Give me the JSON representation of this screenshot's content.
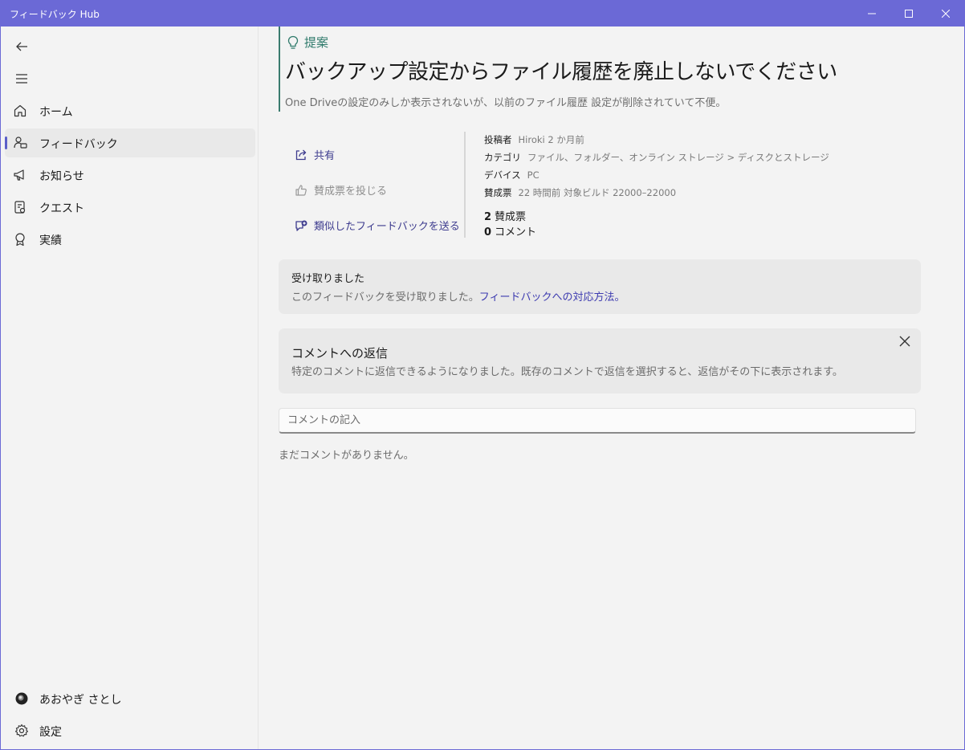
{
  "window": {
    "title": "フィードバック Hub",
    "accent_color": "#6b69d6"
  },
  "sidebar": {
    "items": [
      {
        "label": "ホーム",
        "icon": "home-icon"
      },
      {
        "label": "フィードバック",
        "icon": "feedback-icon",
        "selected": true
      },
      {
        "label": "お知らせ",
        "icon": "megaphone-icon"
      },
      {
        "label": "クエスト",
        "icon": "quest-icon"
      },
      {
        "label": "実績",
        "icon": "achievement-icon"
      }
    ],
    "user": {
      "name": "あおやぎ さとし"
    },
    "settings_label": "設定"
  },
  "post": {
    "category_label": "提案",
    "title": "バックアップ設定からファイル履歴を廃止しないでください",
    "description": "One Driveの設定のみしか表示されないが、以前のファイル履歴 設定が削除されていて不便。"
  },
  "actions": {
    "share": "共有",
    "upvote": "賛成票を投じる",
    "similar": "類似したフィードバックを送る"
  },
  "meta": {
    "author_key": "投稿者",
    "author_value": "Hiroki 2 か月前",
    "category_key": "カテゴリ",
    "category_value": "ファイル、フォルダー、オンライン ストレージ > ディスクとストレージ",
    "device_key": "デバイス",
    "device_value": "PC",
    "votes_key": "賛成票",
    "votes_value": "22 時間前  対象ビルド 22000–22000",
    "vote_count": "2",
    "vote_count_label": "賛成票",
    "comment_count": "0",
    "comment_count_label": "コメント"
  },
  "status_card": {
    "title": "受け取りました",
    "text": "このフィードバックを受け取りました。",
    "link": "フィードバックへの対応方法。"
  },
  "reply_card": {
    "title": "コメントへの返信",
    "text": "特定のコメントに返信できるようになりました。既存のコメントで返信を選択すると、返信がその下に表示されます。"
  },
  "comments": {
    "placeholder": "コメントの記入",
    "empty_text": "まだコメントがありません。"
  }
}
